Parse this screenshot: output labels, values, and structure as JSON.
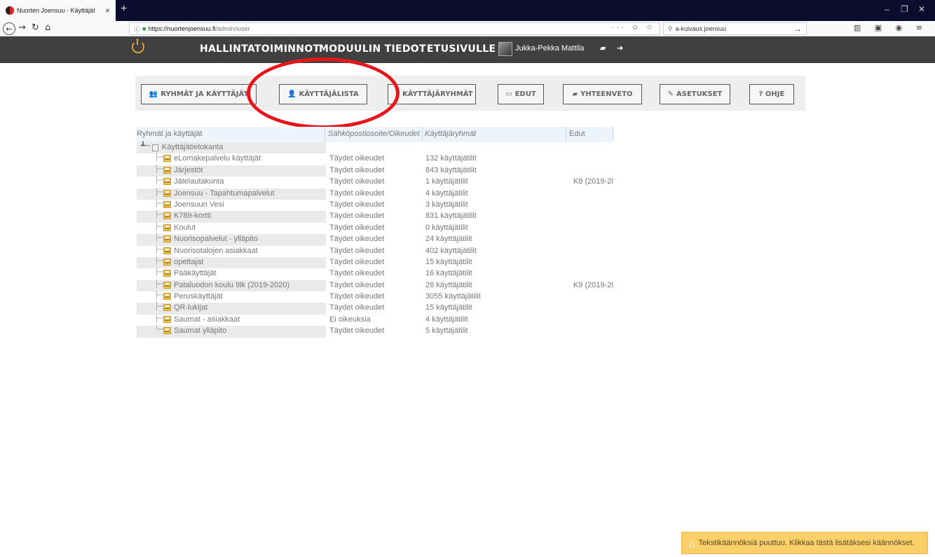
{
  "browser": {
    "tab_title": "Nuorten Joensuu - Käyttäjät",
    "tab_close": "×",
    "new_tab": "+",
    "url_host": "https://nuortenjoensuu.fi",
    "url_path": "/admin/iuser",
    "url_actions": "··· ☺ ☆",
    "search_value": "a-kuivaus joensuu",
    "search_go": "→",
    "toolbar_icons": "▥ ▣ ◉ ≡"
  },
  "app": {
    "accent": "#e0a23a",
    "nav": [
      {
        "label": "HALLINTATOIMINNOT"
      },
      {
        "label": "MODUULIN TIEDOT"
      },
      {
        "label": "ETUSIVULLE"
      }
    ],
    "user_name": "Jukka-Pekka Mattila"
  },
  "toolbar": {
    "buttons": [
      {
        "label": "RYHMÄT JA KÄYTTÄJÄT",
        "icon": "users-icon"
      },
      {
        "label": "KÄYTTÄJÄLISTA",
        "icon": "user-list-icon"
      },
      {
        "label": "KÄYTTÄJÄRYHMÄT",
        "icon": ""
      },
      {
        "label": "EDUT",
        "icon": "card-icon"
      },
      {
        "label": "YHTEENVETO",
        "icon": "book-icon"
      },
      {
        "label": "ASETUKSET",
        "icon": "wrench-icon"
      },
      {
        "label": "? OHJE",
        "icon": ""
      }
    ]
  },
  "grid": {
    "headers": {
      "name": "Ryhmät ja käyttäjät",
      "perm": "Sähköpostiosoite/Oikeudet",
      "groups": "Käyttäjäryhmät",
      "benefits": "Edut"
    },
    "root": "Käyttäjätietokanta",
    "rows": [
      {
        "name": "eLomakepalvelu käyttäjät",
        "perm": "Täydet oikeudet",
        "count": "132 käyttäjätilit",
        "benefit": ""
      },
      {
        "name": "Järjestöt",
        "perm": "Täydet oikeudet",
        "count": "843 käyttäjätilit",
        "benefit": ""
      },
      {
        "name": "Jätelautakunta",
        "perm": "Täydet oikeudet",
        "count": "1 käyttäjätilit",
        "benefit": "K8 (2019-202"
      },
      {
        "name": "Joensuu - Tapahtumapalvelut",
        "perm": "Täydet oikeudet",
        "count": "4 käyttäjätilit",
        "benefit": ""
      },
      {
        "name": "Joensuun Vesi",
        "perm": "Täydet oikeudet",
        "count": "3 käyttäjätilit",
        "benefit": ""
      },
      {
        "name": "K789-kortti",
        "perm": "Täydet oikeudet",
        "count": "831 käyttäjätilit",
        "benefit": ""
      },
      {
        "name": "Koulut",
        "perm": "Täydet oikeudet",
        "count": "0 käyttäjätilit",
        "benefit": ""
      },
      {
        "name": "Nuorisopalvelut - ylläpito",
        "perm": "Täydet oikeudet",
        "count": "24 käyttäjätilit",
        "benefit": ""
      },
      {
        "name": "Nuorisotalojen asiakkaat",
        "perm": "Täydet oikeudet",
        "count": "402 käyttäjätilit",
        "benefit": ""
      },
      {
        "name": "opettajat",
        "perm": "Täydet oikeudet",
        "count": "15 käyttäjätilit",
        "benefit": ""
      },
      {
        "name": "Pääkäyttäjät",
        "perm": "Täydet oikeudet",
        "count": "16 käyttäjätilit",
        "benefit": ""
      },
      {
        "name": "Pataluodon koulu 9lk (2019-2020)",
        "perm": "Täydet oikeudet",
        "count": "26 käyttäjätilit",
        "benefit": "K9 (2019-202"
      },
      {
        "name": "Peruskäyttäjät",
        "perm": "Täydet oikeudet",
        "count": "3055 käyttäjätilit",
        "benefit": ""
      },
      {
        "name": "QR-lukijat",
        "perm": "Täydet oikeudet",
        "count": "15 käyttäjätilit",
        "benefit": ""
      },
      {
        "name": "Saumat - asiakkaat",
        "perm": "Ei oikeuksia",
        "count": "4 käyttäjätilit",
        "benefit": ""
      },
      {
        "name": "Saumat ylläpito",
        "perm": "Täydet oikeudet",
        "count": "5 käyttäjätilit",
        "benefit": ""
      }
    ]
  },
  "notice": {
    "text": "Tekstikäännöksiä puuttuu. Klikkaa tästä lisätäksesi käännökset."
  }
}
